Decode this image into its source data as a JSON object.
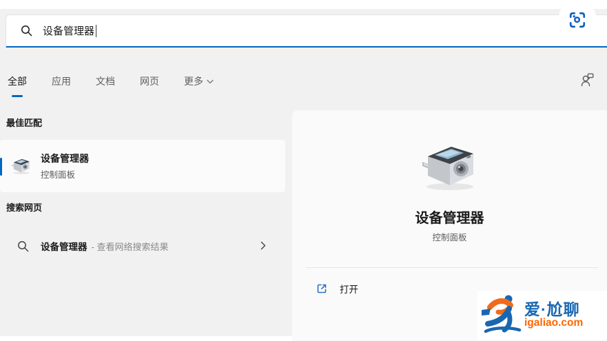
{
  "colors": {
    "accent": "#0067c0",
    "watermark_blue": "#1a67b1",
    "watermark_orange": "#ff6600"
  },
  "search_bar": {
    "query": "设备管理器"
  },
  "tabs": [
    {
      "label": "全部",
      "active": true
    },
    {
      "label": "应用",
      "active": false
    },
    {
      "label": "文档",
      "active": false
    },
    {
      "label": "网页",
      "active": false
    },
    {
      "label": "更多",
      "active": false,
      "has_menu": true
    }
  ],
  "best_match": {
    "header": "最佳匹配",
    "result": {
      "title": "设备管理器",
      "subtitle": "控制面板"
    }
  },
  "web_search": {
    "header": "搜索网页",
    "suggestion": {
      "query": "设备管理器",
      "hint": "- 查看网络搜索结果"
    }
  },
  "preview": {
    "title": "设备管理器",
    "subtitle": "控制面板",
    "open_label": "打开"
  },
  "watermark": {
    "name": "爱·尬聊",
    "site": "igaliao.com"
  }
}
